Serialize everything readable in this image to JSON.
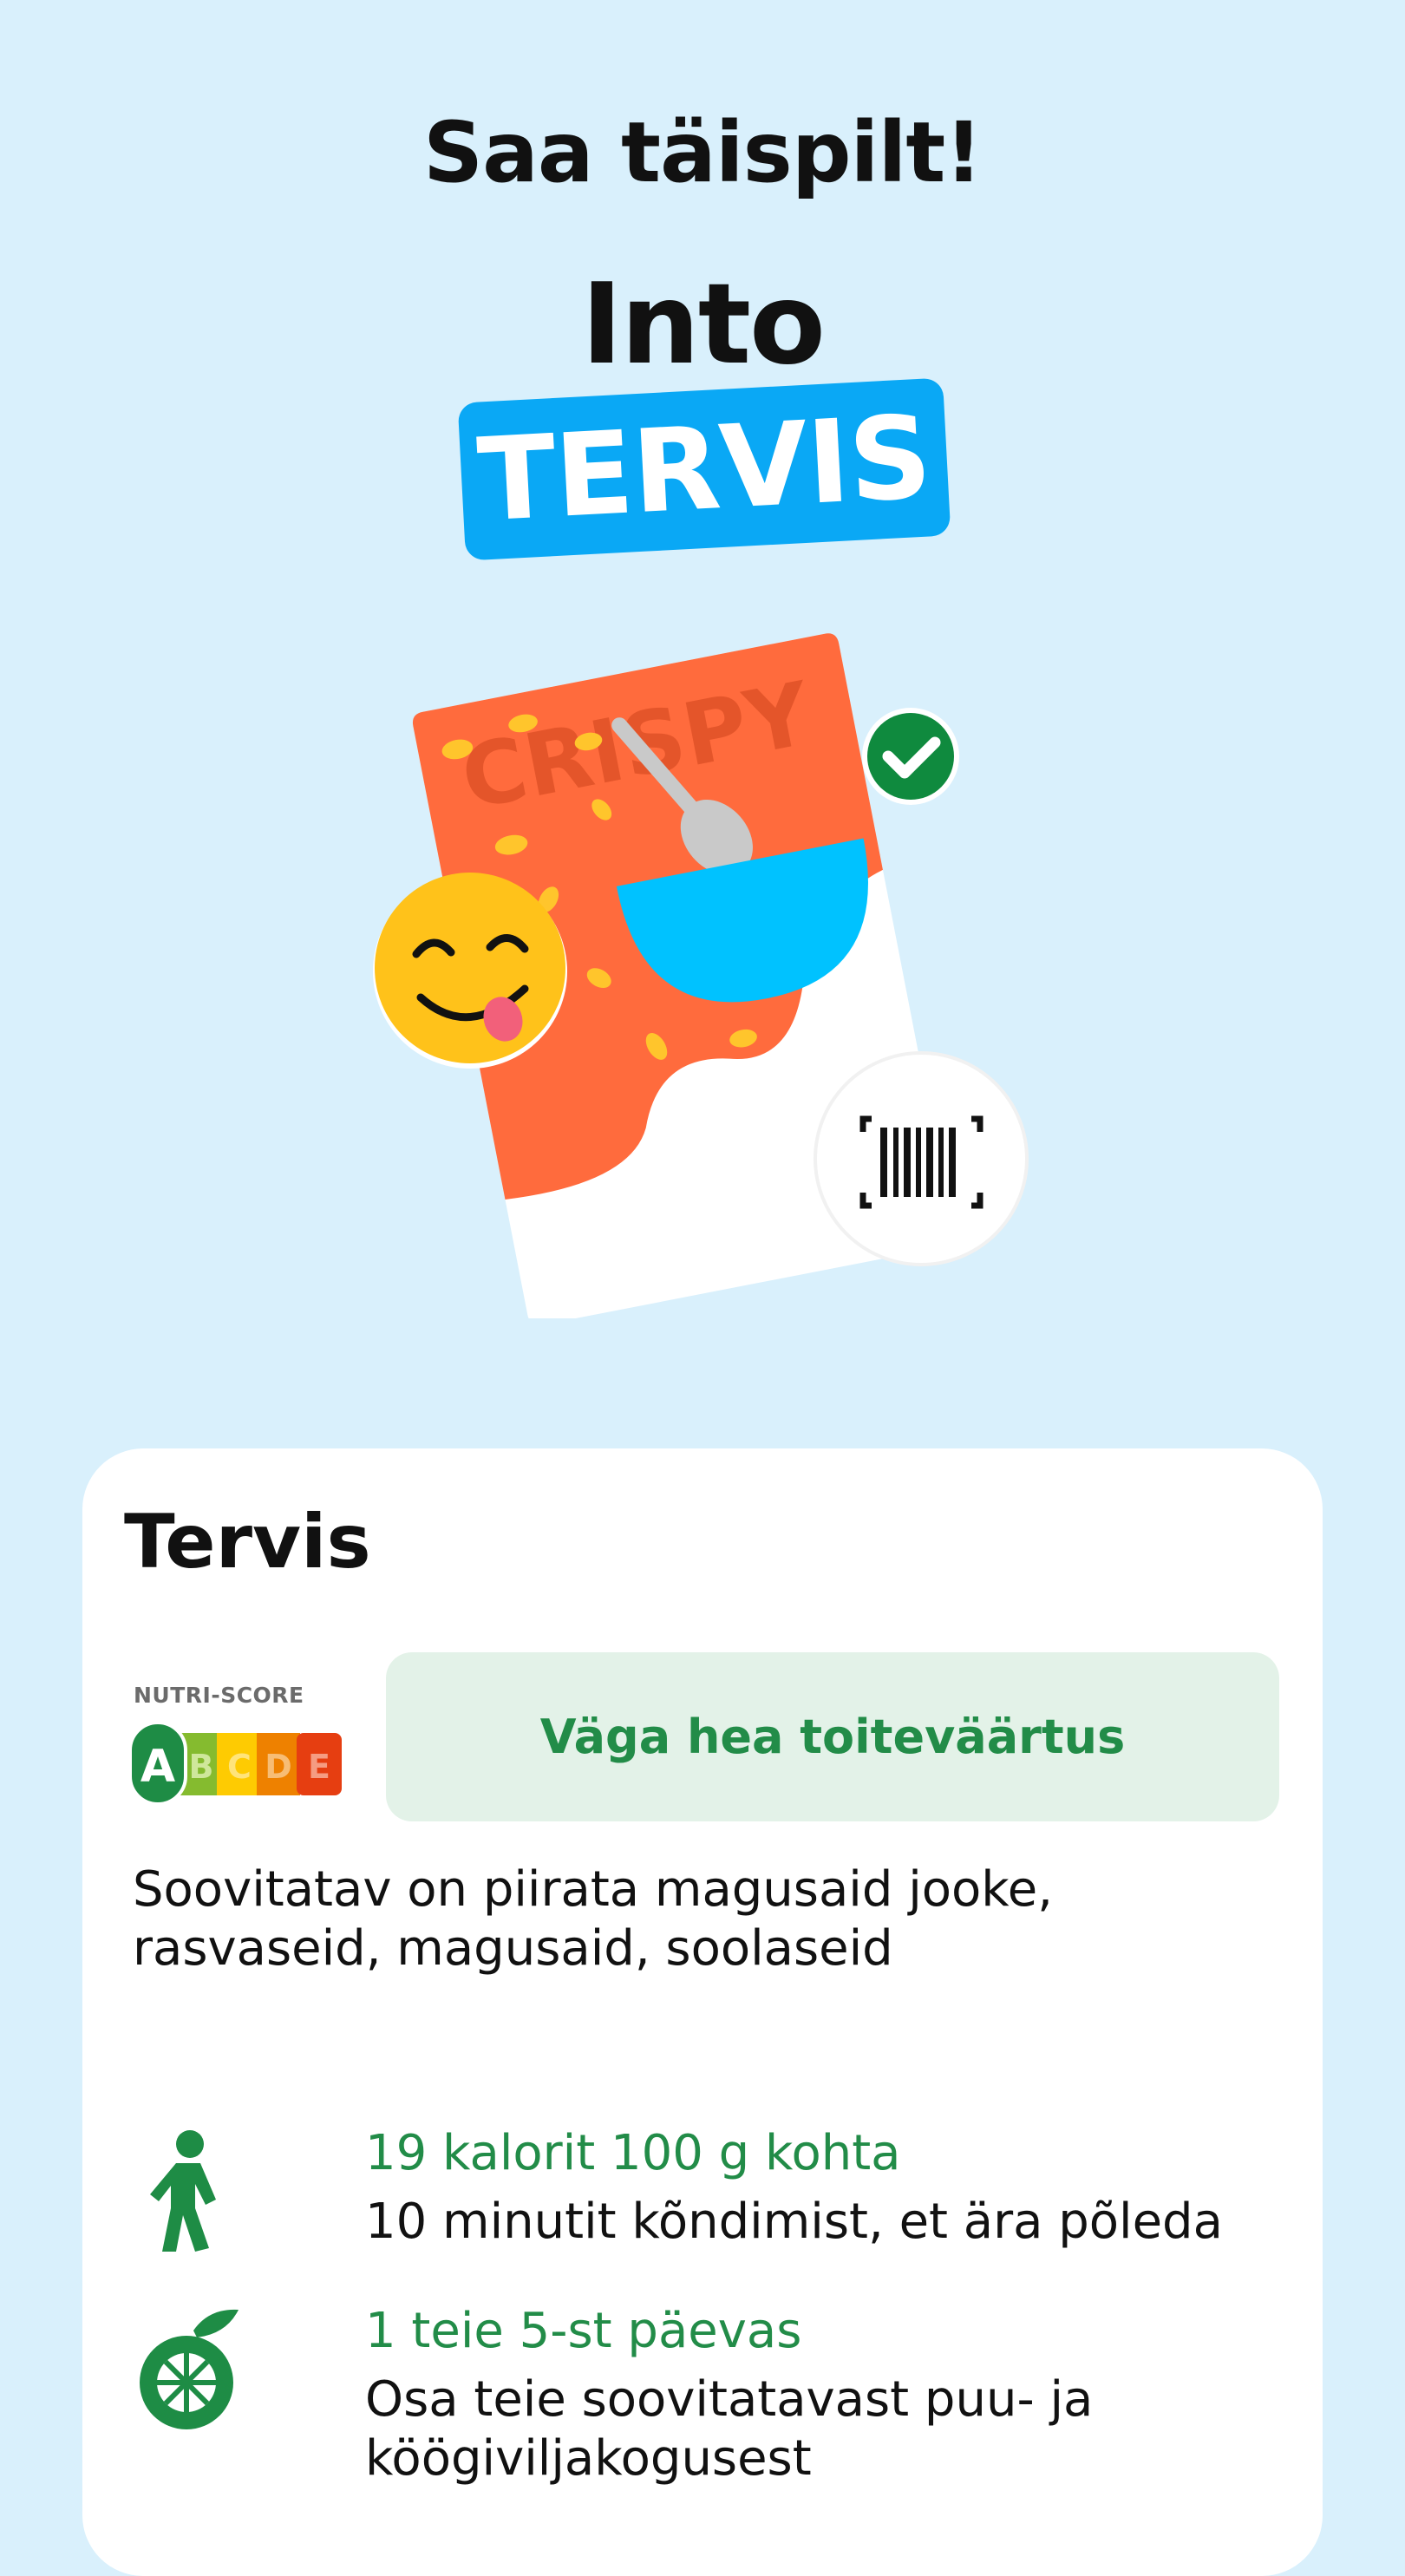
{
  "header": {
    "headline": "Saa täispilt!",
    "into": "Into",
    "tag": "TERVIS"
  },
  "illustration": {
    "package_word": "CRISPY"
  },
  "card": {
    "title": "Tervis",
    "nutri_score": {
      "label": "NUTRI-SCORE",
      "grades": [
        "A",
        "B",
        "C",
        "D",
        "E"
      ],
      "selected": "A",
      "colors": [
        "#1e8c45",
        "#85bb2f",
        "#fecb02",
        "#ee8100",
        "#e63e11"
      ]
    },
    "grade_text": "Väga hea toiteväärtus",
    "advice": "Soovitatav on piirata magusaid jooke, rasvaseid, magusaid, soolaseid",
    "facts": [
      {
        "icon": "walking-person-icon",
        "title": "19 kalorit 100 g kohta",
        "desc": "10 minutit kõndimist, et ära põleda"
      },
      {
        "icon": "orange-fruit-icon",
        "title": "1 teie 5-st päevas",
        "desc": "Osa teie soovitatavast puu- ja köögiviljakogusest"
      }
    ]
  },
  "colors": {
    "background": "#d9f0fc",
    "accent_blue": "#0aa8f5",
    "green": "#228c48"
  }
}
